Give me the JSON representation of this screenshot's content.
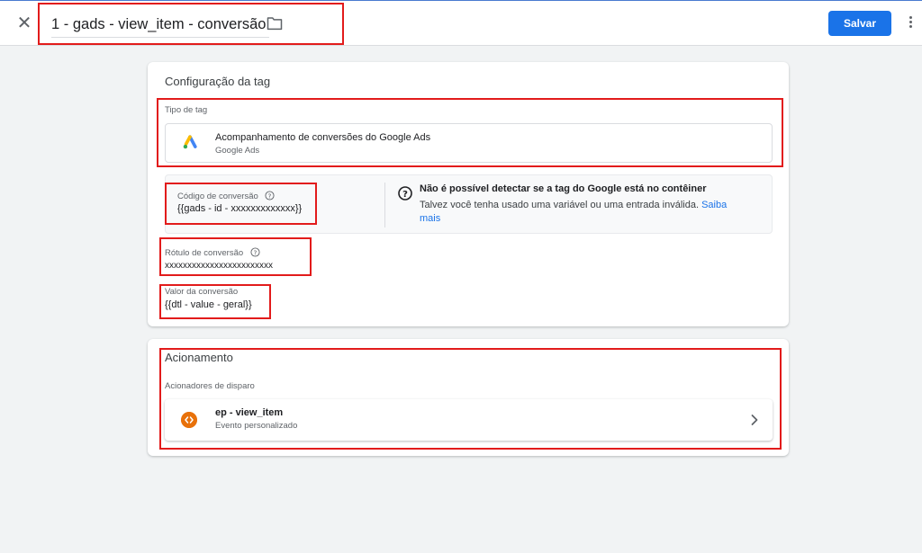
{
  "header": {
    "close_icon": "close-icon",
    "title": "1 - gads - view_item - conversão",
    "folder_icon": "folder-icon",
    "save_label": "Salvar",
    "more_icon": "more-vert-icon"
  },
  "tag_config": {
    "card_title": "Configuração da tag",
    "tag_type_label": "Tipo de tag",
    "tag_type_name": "Acompanhamento de conversões do Google Ads",
    "tag_type_sub": "Google Ads",
    "conversion_id_label": "Código de conversão",
    "conversion_id_value": "{{gads - id - xxxxxxxxxxxxx}}",
    "warning_title": "Não é possível detectar se a tag do Google está no contêiner",
    "warning_text": "Talvez você tenha usado uma variável ou uma entrada inválida.",
    "warning_link": "Saiba mais",
    "conversion_label_label": "Rótulo de conversão",
    "conversion_label_value": "xxxxxxxxxxxxxxxxxxxxxxxx",
    "conversion_value_label": "Valor da conversão",
    "conversion_value_value": "{{dtl - value - geral}}"
  },
  "triggering": {
    "card_title": "Acionamento",
    "firing_label": "Acionadores de disparo",
    "trigger_name": "ep - view_item",
    "trigger_sub": "Evento personalizado"
  },
  "colors": {
    "accent": "#1a73e8",
    "annotation": "#e21b1b",
    "trigger_icon": "#e8710a"
  }
}
